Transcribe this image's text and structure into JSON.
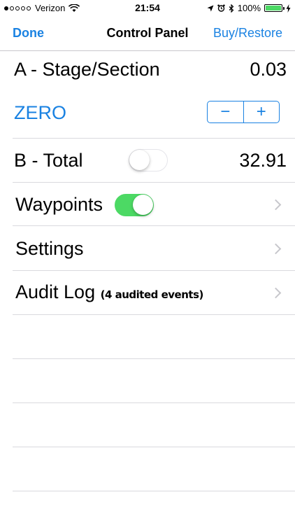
{
  "status_bar": {
    "carrier": "Verizon",
    "time": "21:54",
    "battery": "100%",
    "signal_filled": 1,
    "signal_total": 5
  },
  "nav": {
    "left": "Done",
    "title": "Control Panel",
    "right": "Buy/Restore"
  },
  "stage": {
    "label": "A - Stage/Section",
    "value": "0.03"
  },
  "zero": {
    "label": "ZERO",
    "stepper_minus": "−",
    "stepper_plus": "+"
  },
  "total": {
    "label": "B - Total",
    "value": "32.91",
    "toggle_on": false
  },
  "waypoints": {
    "label": "Waypoints",
    "toggle_on": true
  },
  "settings": {
    "label": "Settings"
  },
  "audit": {
    "label": "Audit Log",
    "sub": "(4 audited events)"
  },
  "colors": {
    "accent": "#1a82e2",
    "toggle_on": "#4cd964",
    "separator": "#d9d9de"
  }
}
